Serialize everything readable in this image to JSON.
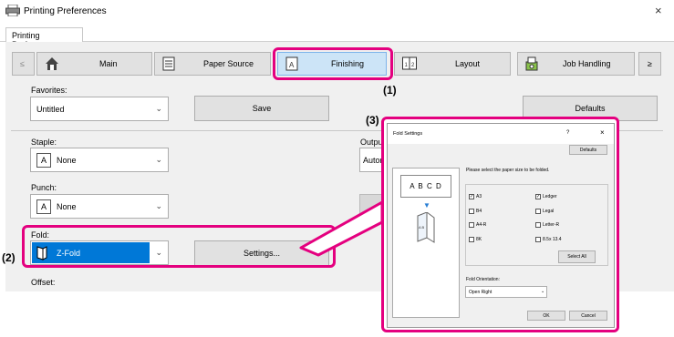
{
  "window": {
    "title": "Printing Preferences",
    "close": "×"
  },
  "tab": {
    "label": "Printing Preferences"
  },
  "nav": {
    "prev": "≤",
    "next": "≥"
  },
  "categories": [
    {
      "label": "Main",
      "icon": "home-icon"
    },
    {
      "label": "Paper Source",
      "icon": "paper-tray-icon"
    },
    {
      "label": "Finishing",
      "icon": "finishing-icon",
      "selected": true
    },
    {
      "label": "Layout",
      "icon": "layout-icon"
    },
    {
      "label": "Job Handling",
      "icon": "job-handling-icon"
    }
  ],
  "callouts": {
    "c1": "(1)",
    "c2": "(2)",
    "c3": "(3)"
  },
  "favorites": {
    "label": "Favorites:",
    "value": "Untitled",
    "save": "Save",
    "defaults": "Defaults"
  },
  "staple": {
    "label": "Staple:",
    "value": "None"
  },
  "punch": {
    "label": "Punch:",
    "value": "None"
  },
  "fold": {
    "label": "Fold:",
    "value": "Z-Fold",
    "settings": "Settings..."
  },
  "offset": {
    "label": "Offset:"
  },
  "output": {
    "label": "Outpu",
    "value": "Autor"
  },
  "fold_dialog": {
    "title": "Fold Settings",
    "help": "?",
    "close": "×",
    "defaults": "Defaults",
    "preview_text": "A B C D",
    "instruction": "Please select the paper size to be folded.",
    "sizes_left": [
      {
        "label": "A3",
        "checked": true
      },
      {
        "label": "B4",
        "checked": false
      },
      {
        "label": "A4-R",
        "checked": false
      },
      {
        "label": "8K",
        "checked": false
      }
    ],
    "sizes_right": [
      {
        "label": "Ledger",
        "checked": true
      },
      {
        "label": "Legal",
        "checked": false
      },
      {
        "label": "Letter-R",
        "checked": false
      },
      {
        "label": "8.5x 13.4",
        "checked": false
      }
    ],
    "select_all": "Select All",
    "orientation_label": "Fold Orientation:",
    "orientation_value": "Open Right",
    "ok": "OK",
    "cancel": "Cancel"
  },
  "colors": {
    "accent": "#e4007f",
    "selected": "#0078d7"
  }
}
